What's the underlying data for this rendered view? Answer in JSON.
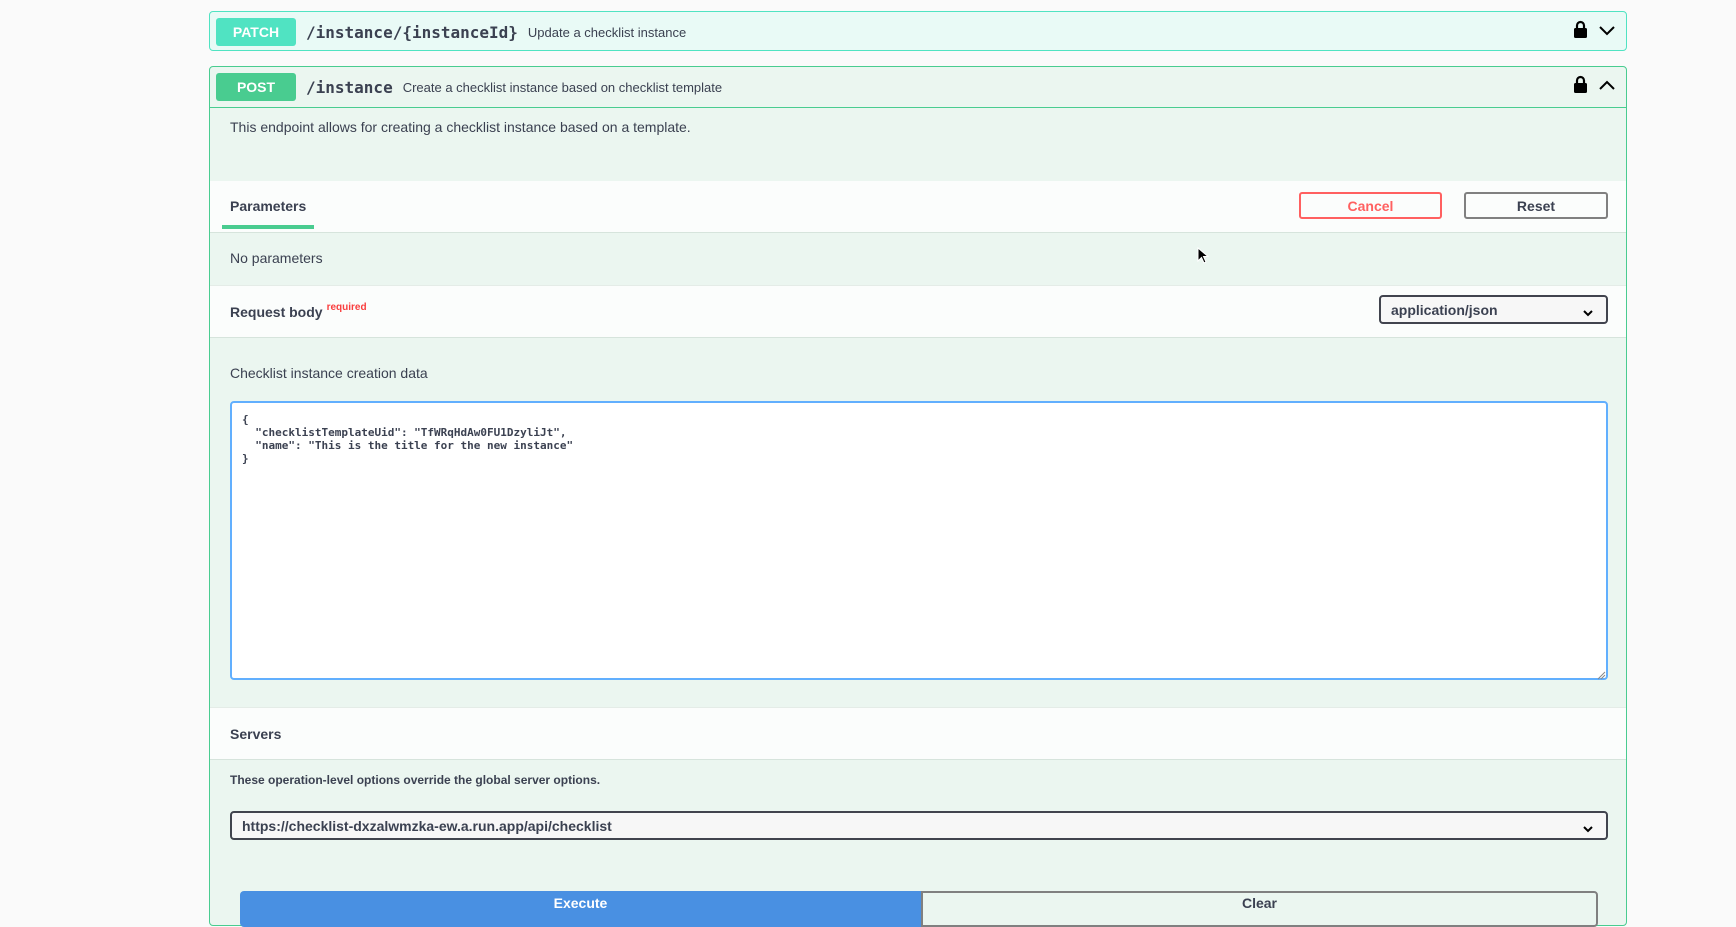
{
  "patch_block": {
    "method": "PATCH",
    "path": "/instance/{instanceId}",
    "summary": "Update a checklist instance",
    "icons": [
      "lock-icon",
      "chevron-down-icon"
    ]
  },
  "post_block": {
    "method": "POST",
    "path": "/instance",
    "summary": "Create a checklist instance based on checklist template",
    "icons": [
      "lock-icon",
      "chevron-up-icon"
    ],
    "description": "This endpoint allows for creating a checklist instance based on a template.",
    "parameters": {
      "tab_label": "Parameters",
      "cancel_label": "Cancel",
      "reset_label": "Reset",
      "empty_text": "No parameters"
    },
    "request_body": {
      "title": "Request body",
      "required_label": "required",
      "content_type": "application/json",
      "description": "Checklist instance creation data",
      "value": "{\n  \"checklistTemplateUid\": \"TfWRqHdAw0FU1DzyliJt\",\n  \"name\": \"This is the title for the new instance\"\n}"
    },
    "servers": {
      "title": "Servers",
      "note": "These operation-level options override the global server options.",
      "selected": "https://checklist-dxzalwmzka-ew.a.run.app/api/checklist"
    },
    "actions": {
      "execute_label": "Execute",
      "clear_label": "Clear"
    }
  },
  "colors": {
    "post": "#49cc90",
    "patch": "#50e3c2",
    "cancel": "#ff6060",
    "execute": "#4990e2"
  }
}
